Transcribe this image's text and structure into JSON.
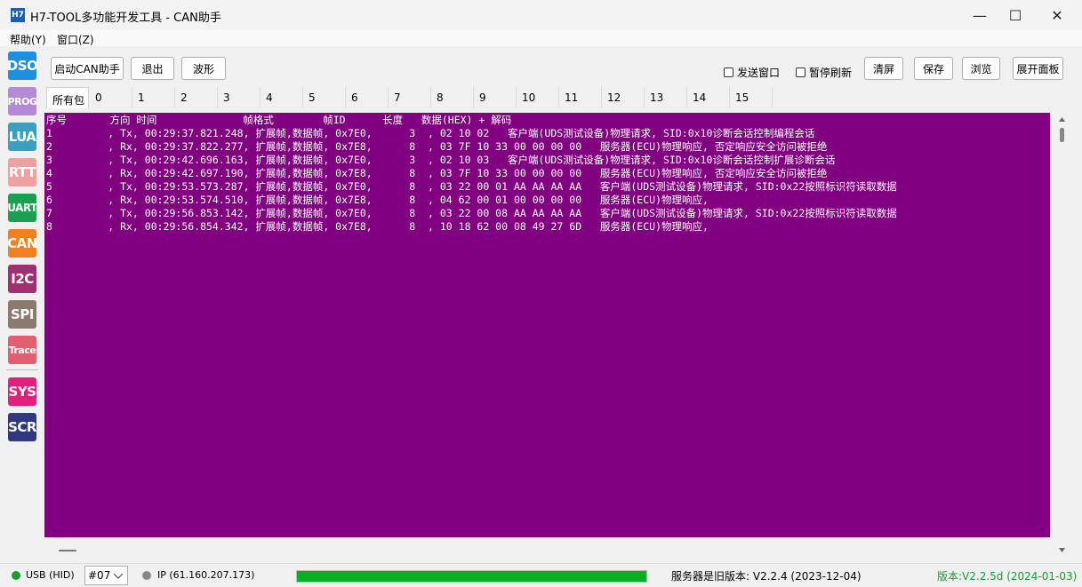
{
  "window": {
    "icon_text": "H7",
    "title": "H7-TOOL多功能开发工具 - CAN助手",
    "minimize": "—",
    "maximize": "☐",
    "close": "✕"
  },
  "menu": {
    "help": "帮助(Y)",
    "window": "窗口(Z)"
  },
  "sidebar": {
    "items": [
      {
        "label": "DSO",
        "color": "#1e90e0"
      },
      {
        "label": "PROG",
        "color": "#b48ad6"
      },
      {
        "label": "LUA",
        "color": "#3aa0c0"
      },
      {
        "label": "RTT",
        "color": "#f0a0a0"
      },
      {
        "label": "UART",
        "color": "#1aa050"
      },
      {
        "label": "CAN",
        "color": "#f08020"
      },
      {
        "label": "I2C",
        "color": "#a03070"
      },
      {
        "label": "SPI",
        "color": "#8a7a70"
      },
      {
        "label": "Trace",
        "color": "#e06070"
      },
      {
        "label": "SYS",
        "color": "#e0207a"
      },
      {
        "label": "SCR",
        "color": "#303880"
      }
    ]
  },
  "toolbar": {
    "start": "启动CAN助手",
    "exit": "退出",
    "wave": "波形",
    "send_window": "发送窗口",
    "pause_refresh": "暂停刷新",
    "clear": "清屏",
    "save": "保存",
    "browse": "浏览",
    "expand": "展开面板"
  },
  "tabs": [
    "所有包",
    "0",
    "1",
    "2",
    "3",
    "4",
    "5",
    "6",
    "7",
    "8",
    "9",
    "10",
    "11",
    "12",
    "13",
    "14",
    "15"
  ],
  "log": {
    "header": "序号       方向 时间              帧格式        帧ID      长度   数据(HEX) + 解码",
    "rows": [
      "1         , Tx, 00:29:37.821.248, 扩展帧,数据帧, 0x7E0,      3  , 02 10 02   客户端(UDS测试设备)物理请求, SID:0x10诊断会话控制编程会话",
      "2         , Rx, 00:29:37.822.277, 扩展帧,数据帧, 0x7E8,      8  , 03 7F 10 33 00 00 00 00   服务器(ECU)物理响应, 否定响应安全访问被拒绝",
      "3         , Tx, 00:29:42.696.163, 扩展帧,数据帧, 0x7E0,      3  , 02 10 03   客户端(UDS测试设备)物理请求, SID:0x10诊断会话控制扩展诊断会话",
      "4         , Rx, 00:29:42.697.190, 扩展帧,数据帧, 0x7E8,      8  , 03 7F 10 33 00 00 00 00   服务器(ECU)物理响应, 否定响应安全访问被拒绝",
      "5         , Tx, 00:29:53.573.287, 扩展帧,数据帧, 0x7E0,      8  , 03 22 00 01 AA AA AA AA   客户端(UDS测试设备)物理请求, SID:0x22按照标识符读取数据",
      "6         , Rx, 00:29:53.574.510, 扩展帧,数据帧, 0x7E8,      8  , 04 62 00 01 00 00 00 00   服务器(ECU)物理响应,",
      "7         , Tx, 00:29:56.853.142, 扩展帧,数据帧, 0x7E0,      8  , 03 22 00 08 AA AA AA AA   客户端(UDS测试设备)物理请求, SID:0x22按照标识符读取数据",
      "8         , Rx, 00:29:56.854.342, 扩展帧,数据帧, 0x7E8,      8  , 10 18 62 00 08 49 27 6D   服务器(ECU)物理响应,"
    ],
    "background": "#800080"
  },
  "status": {
    "usb": "USB (HID)",
    "usb_color": "#1a9a30",
    "port": "#07",
    "ip": "IP (61.160.207.173)",
    "ip_color": "#888888",
    "progress": 1.0,
    "server_version": "服务器是旧版本: V2.2.4 (2023-12-04)",
    "version": "版本:V2.2.5d (2024-01-03)",
    "version_color": "#1a9a30"
  }
}
